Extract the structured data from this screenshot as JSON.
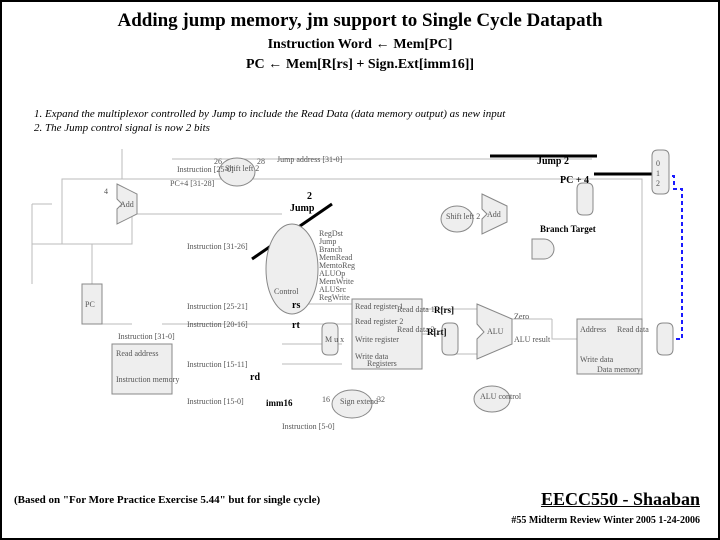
{
  "title": "Adding jump memory, jm support to Single Cycle Datapath",
  "line1_a": "Instruction Word",
  "line1_b": "Mem[PC]",
  "line2_a": "PC",
  "line2_b": "Mem[R[rs] + Sign.Ext[imm16]]",
  "note": "1.  Expand the multiplexor controlled by Jump to include the Read Data (data memory output) as new input 2.   The Jump control signal is now 2 bits",
  "labels": {
    "jump2": "Jump   2",
    "pc4": "PC + 4",
    "two": "2",
    "jump": "Jump",
    "branch": "Branch Target",
    "rs": "rs",
    "rt": "rt",
    "rd": "rd",
    "rrs": "R[rs]",
    "rrt": "R[rt]",
    "imm16": "imm16",
    "shift": "Shift\\nleft 2",
    "add": "Add",
    "pc": "PC",
    "instrmem": "Instruction\\nmemory",
    "readaddr": "Read\\naddress",
    "instr3126": "Instruction [31-26]",
    "instr2521": "Instruction [25-21]",
    "instr2016": "Instruction [20-16]",
    "instr1511": "Instruction [15-11]",
    "instr150": "Instruction [15-0]",
    "instr310": "Instruction\\n[31-0]",
    "instr250": "Instruction [25-0]",
    "jumpaddr": "Jump address [31-0]",
    "pc43128": "PC+4 [31-28]",
    "control": "Control",
    "regdst": "RegDst",
    "jumpc": "Jump",
    "branchc": "Branch",
    "memread": "MemRead",
    "memtoreg": "MemtoReg",
    "aluop": "ALUOp",
    "memwrite": "MemWrite",
    "alusrc": "ALUSrc",
    "regwrite": "RegWrite",
    "regfile": "Registers",
    "rr1": "Read\\nregister 1",
    "rr2": "Read\\nregister 2",
    "wr": "Write\\nregister",
    "wd": "Write\\ndata",
    "rd1": "Read\\ndata 1",
    "rd2": "Read\\ndata 2",
    "signext": "Sign\\nextend",
    "sixteen": "16",
    "thirtytwo": "32",
    "alu": "ALU",
    "zero": "Zero",
    "alures": "ALU\\nresult",
    "aluctrl": "ALU\\ncontrol",
    "datamem": "Data\\nmemory",
    "addr": "Address",
    "rdata": "Read\\ndata",
    "wdata": "Write\\ndata",
    "instr50": "Instruction [5-0]",
    "twentysix": "26",
    "twentyeight": "28",
    "four": "4",
    "one": "1",
    "zero0": "0",
    "mux": "M\\nu\\nx"
  },
  "footer_l": "(Based on \"For More Practice Exercise 5.44\" but for single cycle)",
  "footer_r": "EECC550 - Shaaban",
  "footer_r2": "#55   Midterm Review  Winter 2005  1-24-2006"
}
